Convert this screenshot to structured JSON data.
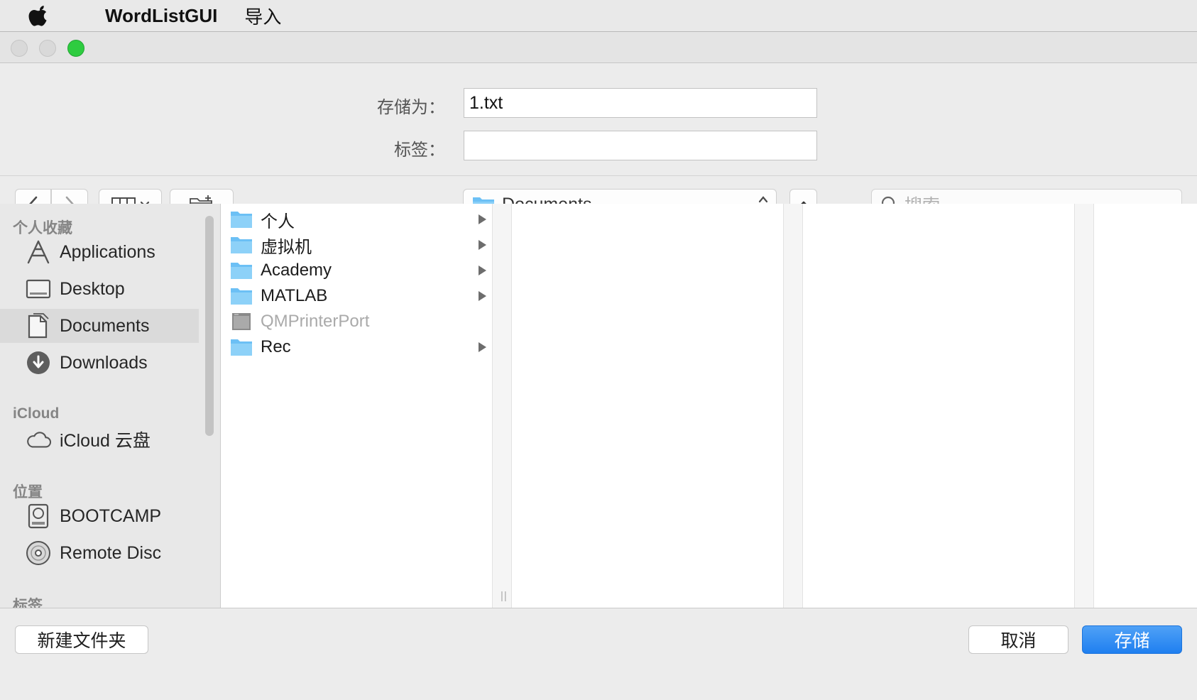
{
  "menubar": {
    "app_name": "WordListGUI",
    "menu_items": [
      "导入"
    ]
  },
  "form": {
    "save_as_label": "存储为：",
    "save_as_value": "1.txt",
    "tags_label": "标签：",
    "tags_value": ""
  },
  "toolbar": {
    "path": "Documents",
    "search_placeholder": "搜索"
  },
  "sidebar": {
    "sections": [
      {
        "title": "个人收藏",
        "items": [
          {
            "label": "Applications",
            "icon": "applications-icon"
          },
          {
            "label": "Desktop",
            "icon": "desktop-icon"
          },
          {
            "label": "Documents",
            "icon": "documents-icon",
            "selected": true
          },
          {
            "label": "Downloads",
            "icon": "downloads-icon"
          }
        ]
      },
      {
        "title": "iCloud",
        "items": [
          {
            "label": "iCloud 云盘",
            "icon": "cloud-icon"
          }
        ]
      },
      {
        "title": "位置",
        "items": [
          {
            "label": "BOOTCAMP",
            "icon": "disk-icon"
          },
          {
            "label": "Remote Disc",
            "icon": "disc-icon"
          }
        ]
      },
      {
        "title": "标签",
        "items": []
      }
    ]
  },
  "files": [
    {
      "name": "个人",
      "type": "folder",
      "has_children": true
    },
    {
      "name": "虚拟机",
      "type": "folder",
      "has_children": true
    },
    {
      "name": "Academy",
      "type": "folder",
      "has_children": true
    },
    {
      "name": "MATLAB",
      "type": "folder",
      "has_children": true
    },
    {
      "name": "QMPrinterPort",
      "type": "file",
      "dimmed": true,
      "has_children": false
    },
    {
      "name": "Rec",
      "type": "folder",
      "has_children": true
    }
  ],
  "buttons": {
    "new_folder": "新建文件夹",
    "cancel": "取消",
    "save": "存储"
  },
  "colors": {
    "accent": "#1f7ff0",
    "folder": "#6cc0f5",
    "zoom_light": "#2ecc40"
  }
}
